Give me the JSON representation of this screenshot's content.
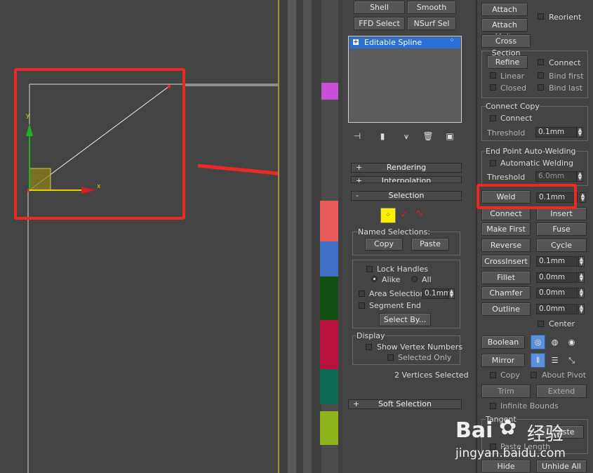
{
  "viewport": {
    "axis_y_label": "y",
    "axis_x_label": "x"
  },
  "modifier_panel": {
    "top_buttons": [
      "Shell",
      "Smooth",
      "FFD Select",
      "NSurf Sel"
    ],
    "stack_item": "Editable Spline",
    "rollouts": {
      "rendering": "Rendering",
      "interpolation": "Interpolation",
      "selection": "Selection",
      "soft_selection": "Soft Selection"
    },
    "named_selections": {
      "label": "Named Selections:",
      "copy": "Copy",
      "paste": "Paste"
    },
    "lock_handles": "Lock Handles",
    "alike": "Alike",
    "all": "All",
    "area_selection": "Area Selection:",
    "area_selection_value": "0.1mm",
    "segment_end": "Segment End",
    "select_by": "Select By...",
    "display": {
      "label": "Display",
      "show_vertex_numbers": "Show Vertex Numbers",
      "selected_only": "Selected Only"
    },
    "status": "2 Vertices Selected"
  },
  "geometry_panel": {
    "attach": "Attach",
    "reorient": "Reorient",
    "attach_mult": "Attach Mult.",
    "cross_section": "Cross Section",
    "refine": "Refine",
    "connect_cb": "Connect",
    "linear": "Linear",
    "bind_first": "Bind first",
    "closed": "Closed",
    "bind_last": "Bind last",
    "connect_copy": {
      "label": "Connect Copy",
      "connect": "Connect",
      "threshold": "Threshold",
      "threshold_value": "0.1mm"
    },
    "auto_weld": {
      "label": "End Point Auto-Welding",
      "automatic_welding": "Automatic Welding",
      "threshold": "Threshold",
      "threshold_value": "6.0mm"
    },
    "weld": "Weld",
    "weld_value": "0.1mm",
    "connect": "Connect",
    "insert": "Insert",
    "make_first": "Make First",
    "fuse": "Fuse",
    "reverse": "Reverse",
    "cycle": "Cycle",
    "cross_insert": "CrossInsert",
    "cross_insert_value": "0.1mm",
    "fillet": "Fillet",
    "fillet_value": "0.0mm",
    "chamfer": "Chamfer",
    "chamfer_value": "0.0mm",
    "outline": "Outline",
    "outline_value": "0.0mm",
    "center": "Center",
    "boolean": "Boolean",
    "mirror": "Mirror",
    "copy": "Copy",
    "about_pivot": "About Pivot",
    "trim": "Trim",
    "extend": "Extend",
    "infinite_bounds": "Infinite Bounds",
    "tangent": "Tangent",
    "paste_partial": "aste",
    "paste_length": "Paste Length",
    "hide": "Hide",
    "unhide_all": "Unhide All"
  },
  "watermark": {
    "brand": "Bai",
    "brand2": "经验",
    "url": "jingyan.baidu.com"
  },
  "colors": {
    "accent_red": "#ec2a25",
    "selection_blue": "#5b8fd6",
    "vertex_yellow": "#ffee00"
  }
}
